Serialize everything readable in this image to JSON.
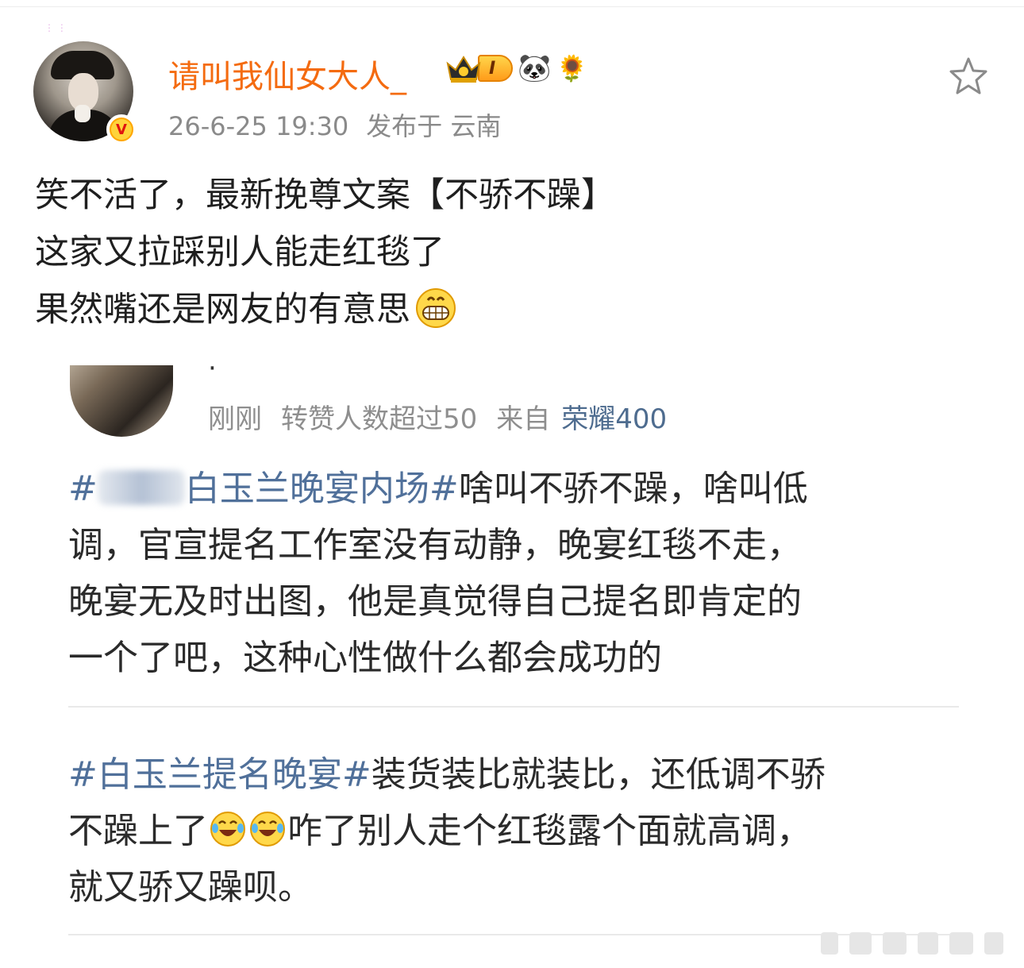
{
  "post": {
    "username": "请叫我仙女大人_",
    "level_badge": "I",
    "timestamp": "26-6-25 19:30",
    "location": "发布于 云南",
    "lines": [
      "笑不活了，最新挽尊文案【不骄不躁】",
      "这家又拉踩别人能走红毯了",
      "果然嘴还是网友的有意思"
    ]
  },
  "comment": {
    "meta_time": "刚刚",
    "meta_stat": "转赞人数超过50",
    "meta_from": "来自",
    "meta_device": "荣耀400"
  },
  "comment1": {
    "topic_visible": "白玉兰晚宴内场#",
    "hash": "#",
    "line1_rest": "啥叫不骄不躁，啥叫低",
    "line2": "调，官宣提名工作室没有动静，晚宴红毯不走，",
    "line3": "晚宴无及时出图，他是真觉得自己提名即肯定的",
    "line4": "一个了吧，这种心性做什么都会成功的"
  },
  "comment2": {
    "topic": "#白玉兰提名晚宴#",
    "line1_rest": "装货装比就装比，还低调不骄",
    "line2_pre": "不躁上了",
    "line2_post": "咋了别人走个红毯露个面就高调，",
    "line3": "就又骄又躁呗。"
  },
  "colors": {
    "username": "#f46b10",
    "topic": "#50709a",
    "meta": "#8a8a8a",
    "device": "#4e6c8f"
  },
  "icons": [
    "avatar",
    "verified-badge",
    "crown-icon",
    "panda-emoji",
    "sunflower-emoji",
    "star-icon",
    "grin-emoji",
    "laugh-cry-emoji"
  ]
}
